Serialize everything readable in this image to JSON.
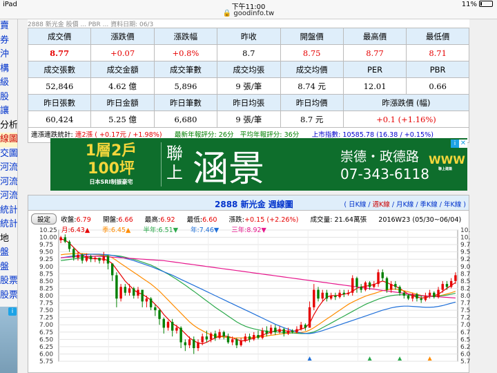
{
  "status_bar": {
    "device": "iPad",
    "time": "下午11:00",
    "battery": "11%"
  },
  "url": "goodinfo.tw",
  "sidebar": {
    "items": [
      {
        "label": "賣",
        "style": "link"
      },
      {
        "label": "券",
        "style": "link"
      },
      {
        "label": "沖",
        "style": "link"
      },
      {
        "label": "構",
        "style": "link"
      },
      {
        "label": "級",
        "style": "link"
      },
      {
        "label": "股",
        "style": "link"
      },
      {
        "label": "讓",
        "style": "link"
      },
      {
        "label": "分析",
        "style": "black"
      },
      {
        "label": "線圖",
        "style": "selected"
      },
      {
        "label": "交圖",
        "style": "link"
      },
      {
        "label": "河流圖",
        "style": "link"
      },
      {
        "label": "河流圖",
        "style": "link"
      },
      {
        "label": "河流圖",
        "style": "link"
      },
      {
        "label": "統計",
        "style": "link"
      },
      {
        "label": "統計",
        "style": "link"
      },
      {
        "label": "地",
        "style": "black"
      },
      {
        "label": "盤",
        "style": "link"
      },
      {
        "label": "盤",
        "style": "link"
      },
      {
        "label": "股票",
        "style": "link"
      },
      {
        "label": "股票",
        "style": "link"
      }
    ],
    "ad_choice": "i"
  },
  "top_strip": "2888 新光金   股價 ...  PBR ...   資料日期: 06/3",
  "quote_table": {
    "rows": [
      {
        "type": "header",
        "cells": [
          "成交價",
          "漲跌價",
          "漲跌幅",
          "昨收",
          "開盤價",
          "最高價",
          "最低價"
        ]
      },
      {
        "type": "data",
        "cells": [
          "8.77",
          "+0.07",
          "+0.8%",
          "8.7",
          "8.75",
          "8.77",
          "8.71"
        ],
        "red": [
          0,
          1,
          2,
          4,
          5,
          6
        ],
        "bold": [
          0
        ]
      },
      {
        "type": "header",
        "cells": [
          "成交張數",
          "成交金額",
          "成交筆數",
          "成交均張",
          "成交均價",
          "PER",
          "PBR"
        ]
      },
      {
        "type": "data",
        "cells": [
          "52,846",
          "4.62 億",
          "5,896",
          "9 張/筆",
          "8.74 元",
          "12.01",
          "0.66"
        ],
        "red": [],
        "bold": []
      },
      {
        "type": "header",
        "cells": [
          "昨日張數",
          "昨日金額",
          "昨日筆數",
          "昨日均張",
          "昨日均價",
          "昨漲跌價 (幅)",
          ""
        ]
      },
      {
        "type": "data",
        "cells": [
          "60,424",
          "5.25 億",
          "6,680",
          "9 張/筆",
          "8.7 元",
          "+0.1 (+1.16%)",
          ""
        ],
        "red": [
          5
        ],
        "bold": []
      }
    ]
  },
  "stat_line": {
    "label1": "連漲連跌統計:",
    "streak": "連2漲",
    "streak_detail": "( +0.17元 / +1.98%)",
    "weekly": "最新年報評分: 26分",
    "avg": "平均年報評分: 36分",
    "index": "上市指數: 10585.78 (16.38 / +0.15%)"
  },
  "banner": {
    "line1": "1層2戶",
    "line2": "100坪",
    "line3": "日本SRI制振豪宅",
    "lian": "聯上",
    "name": "涵景",
    "address": "崇德・政德路",
    "phone": "07-343-6118",
    "logo": "WWW",
    "logo_sub": "聯上建築",
    "ad_choice": "i",
    "close": "✕"
  },
  "chart_panel": {
    "title": "2888 新光金  週線圖",
    "period_links": [
      "日K線",
      "週K線",
      "月K線",
      "季K線",
      "年K線"
    ],
    "selected_period": "週K線",
    "settings_button": "設定",
    "info": {
      "close_label": "收盤:",
      "close": "6.79",
      "open_label": "開盤:",
      "open": "6.66",
      "high_label": "最高:",
      "high": "6.92",
      "low_label": "最低:",
      "low": "6.60",
      "change_label": "漲跌:",
      "change": "+0.15 (+2.26%)",
      "volume": "成交量: 21.64萬張",
      "week": "2016W23 (05/30~06/04)"
    },
    "ma": [
      {
        "label": "月:6.43▲",
        "color": "#e60000"
      },
      {
        "label": "季:6.45▲",
        "color": "#ff8c00"
      },
      {
        "label": "半年:6.51▼",
        "color": "#2aa84a"
      },
      {
        "label": "年:7.46▼",
        "color": "#1e6fd9"
      },
      {
        "label": "三年:8.92▼",
        "color": "#e6168c"
      }
    ]
  },
  "chart_data": {
    "type": "candlestick",
    "ylim": [
      5.75,
      10.25
    ],
    "yticks": [
      "10.25",
      "10.00",
      "9.75",
      "9.50",
      "9.25",
      "9.00",
      "8.75",
      "8.50",
      "8.25",
      "8.00",
      "7.75",
      "7.50",
      "7.25",
      "7.00",
      "6.75",
      "6.50",
      "6.25",
      "6.00",
      "5.75"
    ],
    "candles": [
      [
        9.9,
        10.0,
        10.05,
        9.8
      ],
      [
        10.0,
        9.85,
        10.1,
        9.8
      ],
      [
        9.85,
        9.6,
        9.9,
        9.5
      ],
      [
        9.6,
        9.3,
        9.65,
        9.2
      ],
      [
        9.3,
        9.4,
        9.5,
        9.2
      ],
      [
        9.4,
        9.2,
        9.45,
        9.1
      ],
      [
        9.2,
        9.35,
        9.45,
        9.15
      ],
      [
        9.35,
        9.25,
        9.4,
        9.15
      ],
      [
        9.25,
        9.3,
        9.35,
        9.15
      ],
      [
        9.3,
        9.2,
        9.3,
        9.1
      ],
      [
        9.2,
        9.35,
        9.5,
        9.1
      ],
      [
        9.35,
        9.1,
        9.4,
        8.9
      ],
      [
        9.1,
        8.7,
        9.1,
        8.5
      ],
      [
        8.7,
        7.9,
        8.8,
        7.6
      ],
      [
        7.9,
        8.3,
        8.4,
        7.8
      ],
      [
        8.3,
        8.1,
        8.4,
        8.0
      ],
      [
        8.1,
        8.25,
        8.4,
        8.0
      ],
      [
        8.25,
        8.0,
        8.3,
        7.9
      ],
      [
        8.0,
        8.2,
        8.3,
        7.9
      ],
      [
        8.2,
        7.8,
        8.2,
        7.6
      ],
      [
        7.8,
        7.9,
        8.0,
        7.6
      ],
      [
        7.9,
        7.6,
        7.95,
        7.5
      ],
      [
        7.6,
        7.5,
        7.7,
        7.3
      ],
      [
        7.5,
        7.2,
        7.55,
        7.0
      ],
      [
        7.2,
        6.9,
        7.25,
        6.7
      ],
      [
        6.9,
        7.1,
        7.15,
        6.8
      ],
      [
        7.1,
        6.8,
        7.2,
        6.6
      ],
      [
        6.8,
        6.9,
        7.0,
        6.7
      ],
      [
        6.9,
        6.4,
        6.95,
        6.2
      ],
      [
        6.4,
        6.3,
        6.5,
        6.1
      ],
      [
        6.3,
        6.5,
        6.6,
        6.2
      ],
      [
        6.5,
        6.2,
        6.6,
        6.0
      ],
      [
        6.2,
        6.4,
        6.5,
        6.1
      ],
      [
        6.4,
        6.6,
        6.7,
        6.3
      ],
      [
        6.6,
        6.5,
        6.8,
        6.4
      ],
      [
        6.5,
        6.7,
        6.75,
        6.4
      ],
      [
        6.7,
        6.55,
        6.8,
        6.45
      ],
      [
        6.55,
        6.75,
        6.85,
        6.5
      ],
      [
        6.75,
        6.6,
        6.8,
        6.5
      ],
      [
        6.6,
        6.4,
        6.7,
        6.35
      ],
      [
        6.4,
        6.5,
        6.6,
        6.3
      ],
      [
        6.5,
        6.3,
        6.55,
        6.2
      ],
      [
        6.3,
        6.45,
        6.55,
        6.25
      ],
      [
        6.45,
        6.6,
        6.7,
        6.4
      ],
      [
        6.6,
        6.5,
        6.7,
        6.4
      ],
      [
        6.5,
        6.65,
        6.75,
        6.45
      ],
      [
        6.65,
        6.55,
        6.8,
        6.5
      ],
      [
        6.55,
        6.8,
        6.9,
        6.5
      ],
      [
        6.8,
        6.7,
        6.95,
        6.6
      ],
      [
        6.7,
        6.9,
        7.0,
        6.65
      ],
      [
        6.9,
        6.75,
        7.0,
        6.65
      ],
      [
        6.75,
        6.85,
        6.95,
        6.7
      ],
      [
        6.85,
        6.7,
        6.9,
        6.6
      ],
      [
        6.7,
        6.8,
        6.9,
        6.65
      ],
      [
        6.8,
        6.75,
        6.85,
        6.7
      ],
      [
        6.75,
        6.85,
        6.95,
        6.7
      ],
      [
        6.85,
        7.0,
        7.1,
        6.8
      ],
      [
        7.0,
        6.9,
        7.05,
        6.8
      ],
      [
        6.9,
        7.6,
        7.8,
        6.9
      ],
      [
        7.6,
        8.2,
        8.4,
        7.5
      ],
      [
        8.2,
        7.9,
        8.3,
        7.8
      ],
      [
        7.9,
        8.1,
        8.2,
        7.8
      ],
      [
        8.1,
        7.9,
        8.2,
        7.8
      ],
      [
        7.9,
        8.0,
        8.1,
        7.85
      ],
      [
        8.0,
        7.95,
        8.1,
        7.85
      ],
      [
        7.95,
        8.1,
        8.2,
        7.9
      ],
      [
        8.1,
        8.05,
        8.2,
        7.95
      ],
      [
        8.05,
        8.1,
        8.2,
        8.0
      ],
      [
        8.1,
        8.6,
        8.7,
        8.0
      ],
      [
        8.6,
        8.3,
        8.65,
        8.1
      ],
      [
        8.3,
        8.2,
        8.4,
        8.1
      ],
      [
        8.2,
        8.45,
        8.5,
        8.15
      ],
      [
        8.45,
        8.3,
        8.5,
        8.2
      ],
      [
        8.3,
        8.4,
        8.5,
        8.25
      ],
      [
        8.4,
        8.8,
        8.9,
        8.3
      ],
      [
        8.8,
        8.6,
        8.9,
        8.5
      ],
      [
        8.6,
        8.2,
        8.65,
        8.1
      ],
      [
        8.2,
        8.4,
        8.5,
        8.1
      ],
      [
        8.4,
        8.3,
        8.5,
        8.2
      ],
      [
        8.3,
        8.1,
        8.35,
        8.0
      ],
      [
        8.1,
        8.0,
        8.15,
        7.9
      ],
      [
        8.0,
        7.9,
        8.05,
        7.85
      ],
      [
        7.9,
        8.05,
        8.1,
        7.8
      ],
      [
        8.05,
        7.9,
        8.1,
        7.8
      ],
      [
        7.9,
        7.85,
        8.0,
        7.75
      ],
      [
        7.85,
        8.0,
        8.1,
        7.8
      ],
      [
        8.0,
        8.1,
        8.2,
        7.9
      ],
      [
        8.1,
        7.95,
        8.15,
        7.9
      ],
      [
        7.95,
        8.2,
        8.3,
        7.9
      ],
      [
        8.2,
        8.4,
        8.5,
        8.1
      ],
      [
        8.4,
        8.3,
        8.5,
        8.2
      ],
      [
        8.3,
        8.5,
        8.6,
        8.25
      ],
      [
        8.5,
        8.7,
        8.8,
        8.4
      ]
    ],
    "series": [
      {
        "name": "月",
        "color": "#e60000",
        "values": [
          9.95,
          9.9,
          9.8,
          9.65,
          9.5,
          9.4,
          9.3,
          9.28,
          9.27,
          9.26,
          9.25,
          9.2,
          9.1,
          8.9,
          8.7,
          8.5,
          8.35,
          8.2,
          8.1,
          8.05,
          7.95,
          7.85,
          7.7,
          7.55,
          7.35,
          7.2,
          7.05,
          6.95,
          6.85,
          6.7,
          6.55,
          6.45,
          6.38,
          6.35,
          6.4,
          6.48,
          6.55,
          6.6,
          6.62,
          6.6,
          6.55,
          6.5,
          6.45,
          6.45,
          6.5,
          6.55,
          6.6,
          6.65,
          6.7,
          6.75,
          6.8,
          6.82,
          6.8,
          6.78,
          6.78,
          6.8,
          6.85,
          6.9,
          7.05,
          7.35,
          7.6,
          7.8,
          7.95,
          8.0,
          8.0,
          8.02,
          8.05,
          8.08,
          8.15,
          8.25,
          8.3,
          8.32,
          8.35,
          8.38,
          8.45,
          8.5,
          8.45,
          8.38,
          8.32,
          8.25,
          8.15,
          8.05,
          8.0,
          7.95,
          7.92,
          7.93,
          7.97,
          8.0,
          8.05,
          8.15,
          8.25,
          8.35,
          8.45
        ]
      },
      {
        "name": "季",
        "color": "#ff8c00",
        "values": [
          9.4,
          9.42,
          9.43,
          9.44,
          9.45,
          9.44,
          9.43,
          9.42,
          9.41,
          9.4,
          9.38,
          9.35,
          9.3,
          9.2,
          9.1,
          9.0,
          8.9,
          8.8,
          8.7,
          8.6,
          8.5,
          8.4,
          8.28,
          8.15,
          8.0,
          7.85,
          7.7,
          7.55,
          7.4,
          7.25,
          7.1,
          6.98,
          6.88,
          6.8,
          6.72,
          6.66,
          6.62,
          6.6,
          6.58,
          6.56,
          6.55,
          6.55,
          6.55,
          6.55,
          6.56,
          6.57,
          6.58,
          6.6,
          6.62,
          6.64,
          6.66,
          6.68,
          6.7,
          6.71,
          6.72,
          6.73,
          6.74,
          6.76,
          6.82,
          6.9,
          7.0,
          7.1,
          7.2,
          7.3,
          7.4,
          7.5,
          7.6,
          7.7,
          7.78,
          7.85,
          7.92,
          7.98,
          8.03,
          8.07,
          8.12,
          8.17,
          8.2,
          8.22,
          8.22,
          8.2,
          8.17,
          8.13,
          8.09,
          8.05,
          8.01,
          7.99,
          7.98,
          7.98,
          7.99,
          8.02,
          8.06,
          8.1,
          8.15
        ]
      },
      {
        "name": "半年",
        "color": "#2aa84a",
        "values": [
          9.2,
          9.22,
          9.24,
          9.26,
          9.28,
          9.3,
          9.32,
          9.34,
          9.35,
          9.36,
          9.37,
          9.38,
          9.38,
          9.37,
          9.35,
          9.32,
          9.28,
          9.24,
          9.2,
          9.15,
          9.1,
          9.05,
          8.98,
          8.9,
          8.82,
          8.74,
          8.65,
          8.56,
          8.46,
          8.36,
          8.25,
          8.15,
          8.04,
          7.93,
          7.82,
          7.71,
          7.6,
          7.5,
          7.4,
          7.3,
          7.2,
          7.1,
          7.02,
          6.95,
          6.9,
          6.86,
          6.83,
          6.8,
          6.78,
          6.77,
          6.76,
          6.75,
          6.74,
          6.73,
          6.72,
          6.71,
          6.7,
          6.7,
          6.72,
          6.76,
          6.82,
          6.9,
          6.98,
          7.06,
          7.14,
          7.22,
          7.3,
          7.38,
          7.46,
          7.54,
          7.62,
          7.7,
          7.76,
          7.82,
          7.88,
          7.93,
          7.97,
          8.0,
          8.02,
          8.03,
          8.03,
          8.02,
          8.01,
          8.0,
          7.99,
          7.98,
          7.97,
          7.97,
          7.98,
          8.0,
          8.02,
          8.05,
          8.08
        ]
      },
      {
        "name": "年",
        "color": "#1e6fd9",
        "values": [
          9.3,
          9.32,
          9.34,
          9.36,
          9.38,
          9.4,
          9.41,
          9.42,
          9.42,
          9.42,
          9.41,
          9.4,
          9.38,
          9.35,
          9.32,
          9.28,
          9.24,
          9.2,
          9.15,
          9.1,
          9.05,
          9.0,
          8.94,
          8.88,
          8.82,
          8.76,
          8.7,
          8.63,
          8.56,
          8.49,
          8.42,
          8.35,
          8.28,
          8.21,
          8.14,
          8.07,
          8.0,
          7.93,
          7.86,
          7.79,
          7.72,
          7.65,
          7.58,
          7.51,
          7.44,
          7.37,
          7.3,
          7.23,
          7.16,
          7.09,
          7.02,
          6.96,
          6.9,
          6.85,
          6.8,
          6.76,
          6.72,
          6.7,
          6.7,
          6.72,
          6.76,
          6.8,
          6.85,
          6.9,
          6.95,
          7.0,
          7.05,
          7.1,
          7.15,
          7.2,
          7.25,
          7.3,
          7.35,
          7.4,
          7.45,
          7.5,
          7.54,
          7.58,
          7.61,
          7.63,
          7.64,
          7.64,
          7.63,
          7.62,
          7.61,
          7.6,
          7.6,
          7.61,
          7.63,
          7.66,
          7.7,
          7.74,
          7.78
        ]
      },
      {
        "name": "三年",
        "color": "#e6168c",
        "values": [
          9.3,
          9.31,
          9.32,
          9.33,
          9.34,
          9.35,
          9.35,
          9.35,
          9.35,
          9.35,
          9.34,
          9.33,
          9.32,
          9.31,
          9.3,
          9.29,
          9.28,
          9.27,
          9.26,
          9.25,
          9.24,
          9.23,
          9.22,
          9.21,
          9.2,
          9.18,
          9.16,
          9.14,
          9.12,
          9.1,
          9.08,
          9.06,
          9.04,
          9.02,
          9.0,
          8.98,
          8.96,
          8.94,
          8.92,
          8.9,
          8.88,
          8.86,
          8.84,
          8.82,
          8.8,
          8.78,
          8.76,
          8.74,
          8.72,
          8.7,
          8.68,
          8.66,
          8.64,
          8.62,
          8.6,
          8.58,
          8.56,
          8.54,
          8.52,
          8.5,
          8.48,
          8.46,
          8.44,
          8.42,
          8.4,
          8.38,
          8.36,
          8.34,
          8.32,
          8.3,
          8.28,
          8.26,
          8.24,
          8.22,
          8.2,
          8.18,
          8.16,
          8.14,
          8.12,
          8.1,
          8.08,
          8.06,
          8.04,
          8.02,
          8.0,
          7.99,
          7.98,
          7.97,
          7.96,
          7.95,
          7.94,
          7.93,
          7.92
        ]
      }
    ],
    "markers": [
      {
        "index": 58,
        "color": "#1e6fd9"
      },
      {
        "index": 72,
        "color": "#2aa84a"
      },
      {
        "index": 79,
        "color": "#2aa84a"
      },
      {
        "index": 86,
        "color": "#ff8c00"
      }
    ]
  }
}
